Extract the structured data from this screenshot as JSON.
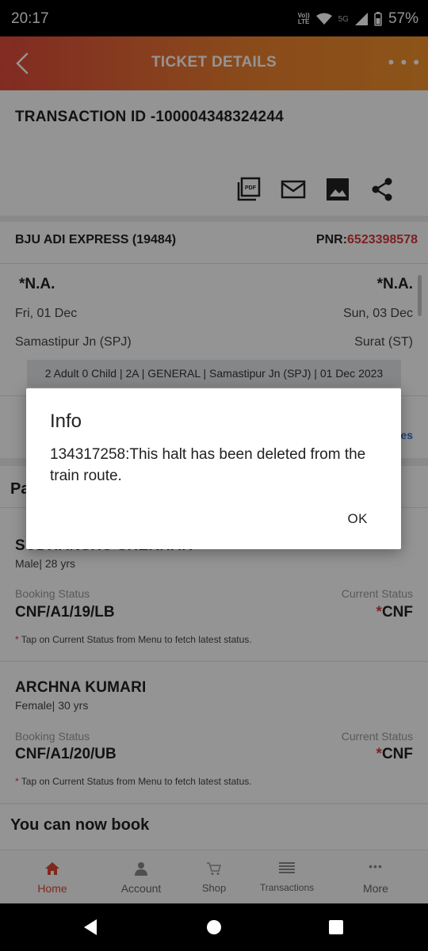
{
  "status_bar": {
    "time": "20:17",
    "lte_top": "Vo))",
    "lte_bottom": "LTE",
    "network": "5G",
    "battery": "57%"
  },
  "header": {
    "title": "TICKET DETAILS"
  },
  "ticket": {
    "transaction_id": "TRANSACTION ID -100004348324244",
    "train": "BJU ADI EXPRESS  (19484)",
    "pnr_label": "PNR:",
    "pnr": "6523398578",
    "from_time": "*N.A.",
    "to_time": "*N.A.",
    "from_date": "Fri, 01 Dec",
    "to_date": "Sun, 03 Dec",
    "from_station": "Samastipur Jn (SPJ)",
    "to_station": "Surat (ST)",
    "summary": "2 Adult 0 Child  | 2A | GENERAL | Samastipur Jn (SPJ) | 01 Dec 2023",
    "partial_link": "es"
  },
  "passengers_partial_title": "Pa",
  "passengers": [
    {
      "name": "SUDHANSHU SHEKHAR",
      "meta": "Male| 28 yrs",
      "booking_label": "Booking Status",
      "current_label": "Current Status",
      "booking_status": "CNF/A1/19/LB",
      "current_star": "*",
      "current_status": "CNF",
      "note_star": "*",
      "note": " Tap on Current Status from Menu to fetch latest status."
    },
    {
      "name": "ARCHNA KUMARI",
      "meta": "Female| 30 yrs",
      "booking_label": "Booking Status",
      "current_label": "Current Status",
      "booking_status": "CNF/A1/20/UB",
      "current_star": "*",
      "current_status": "CNF",
      "note_star": "*",
      "note": " Tap on Current Status from Menu to fetch latest status."
    }
  ],
  "you_can_now_book": "You can now book",
  "bottom_nav": [
    {
      "label": "Home",
      "icon": "home-icon",
      "active": true
    },
    {
      "label": "Account",
      "icon": "account-icon"
    },
    {
      "label": "Shop",
      "icon": "cart-icon"
    },
    {
      "label": "Transactions",
      "icon": "list-icon"
    },
    {
      "label": "More",
      "icon": "more-dots-icon"
    }
  ],
  "dialog": {
    "title": "Info",
    "message": "134317258:This halt has been deleted from the train route.",
    "ok": "OK"
  },
  "colors": {
    "accent": "#d8383a",
    "header_start": "#e04a3b",
    "header_end": "#f2922b",
    "link": "#2a6fd6"
  }
}
